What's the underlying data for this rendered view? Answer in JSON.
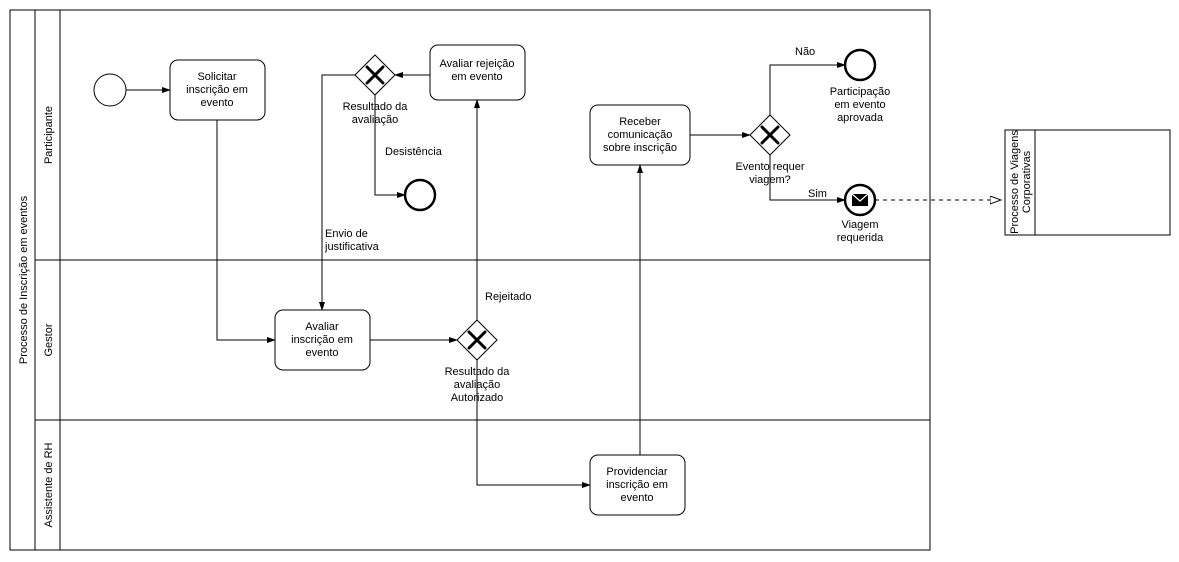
{
  "pool": {
    "title": "Processo de Inscrição em eventos",
    "lanes": [
      {
        "id": "lane1",
        "title": "Participante"
      },
      {
        "id": "lane2",
        "title": "Gestor"
      },
      {
        "id": "lane3",
        "title": "Assistente de RH"
      }
    ]
  },
  "pool2": {
    "title": "Processo de Viagens Corporativas"
  },
  "tasks": {
    "t1": "Solicitar inscrição em evento",
    "t2": "Avaliar rejeição em evento",
    "t3": "Receber comunicação sobre inscrição",
    "t4": "Avaliar inscrição em evento",
    "t5": "Providenciar inscrição em evento"
  },
  "gateways": {
    "g1": "Resultado da avaliação",
    "g2": "Resultado da avaliação",
    "g2b": "Autorizado",
    "g3": "Evento requer viagem?"
  },
  "flows": {
    "f_desist": "Desistência",
    "f_envio_l1": "Envio de",
    "f_envio_l2": "justificativa",
    "f_rej": "Rejeitado",
    "f_nao": "Não",
    "f_sim": "Sim"
  },
  "ends": {
    "e1_l1": "Participação",
    "e1_l2": "em evento",
    "e1_l3": "aprovada",
    "e2_l1": "Viagem",
    "e2_l2": "requerida"
  }
}
